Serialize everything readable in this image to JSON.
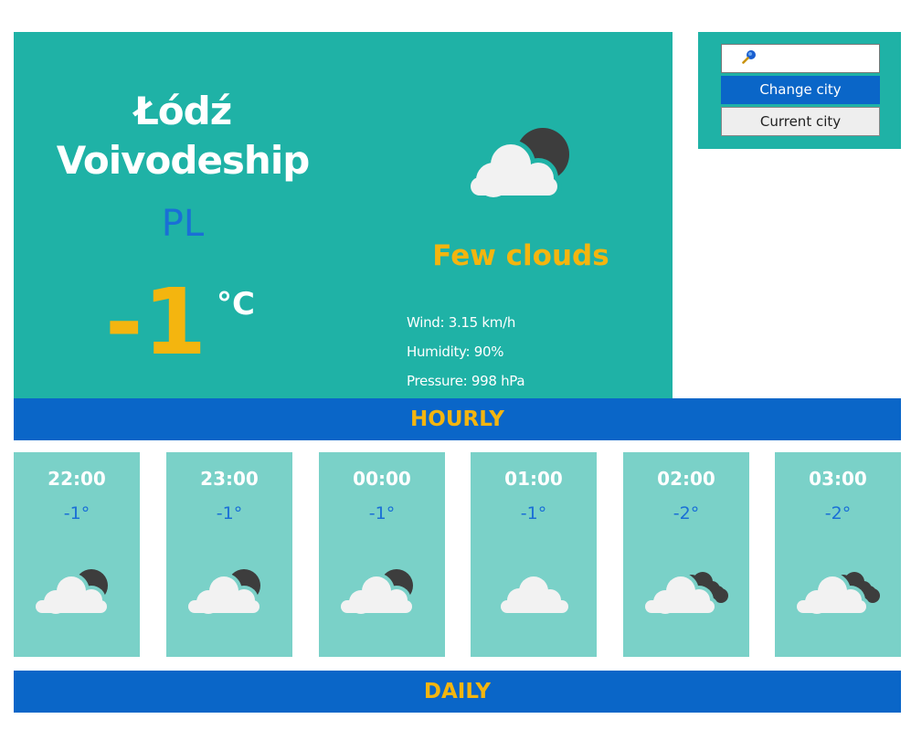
{
  "current": {
    "city": "Łódź Voivodeship",
    "country": "PL",
    "temperature": "-1",
    "unit": "°C",
    "condition": "Few clouds",
    "condition_icon": "cloud-moon-icon",
    "wind": "Wind: 3.15 km/h",
    "humidity": "Humidity: 90%",
    "pressure": "Pressure: 998 hPa"
  },
  "search": {
    "placeholder": "",
    "value": "",
    "change_city_label": "Change city",
    "current_city_label": "Current city"
  },
  "sections": {
    "hourly_label": "HOURLY",
    "daily_label": "DAILY"
  },
  "hourly": [
    {
      "time": "22:00",
      "temp": "-1°",
      "icon": "cloud-moon-icon"
    },
    {
      "time": "23:00",
      "temp": "-1°",
      "icon": "cloud-moon-icon"
    },
    {
      "time": "00:00",
      "temp": "-1°",
      "icon": "cloud-moon-icon"
    },
    {
      "time": "01:00",
      "temp": "-1°",
      "icon": "cloud-icon"
    },
    {
      "time": "02:00",
      "temp": "-2°",
      "icon": "broken-clouds-icon"
    },
    {
      "time": "03:00",
      "temp": "-2°",
      "icon": "broken-clouds-icon"
    }
  ],
  "colors": {
    "panel_teal": "#1fb2a6",
    "card_teal": "#7ad1c8",
    "bar_blue": "#0a66c8",
    "accent_yellow": "#f4b50f",
    "country_blue": "#1a6fd6"
  }
}
